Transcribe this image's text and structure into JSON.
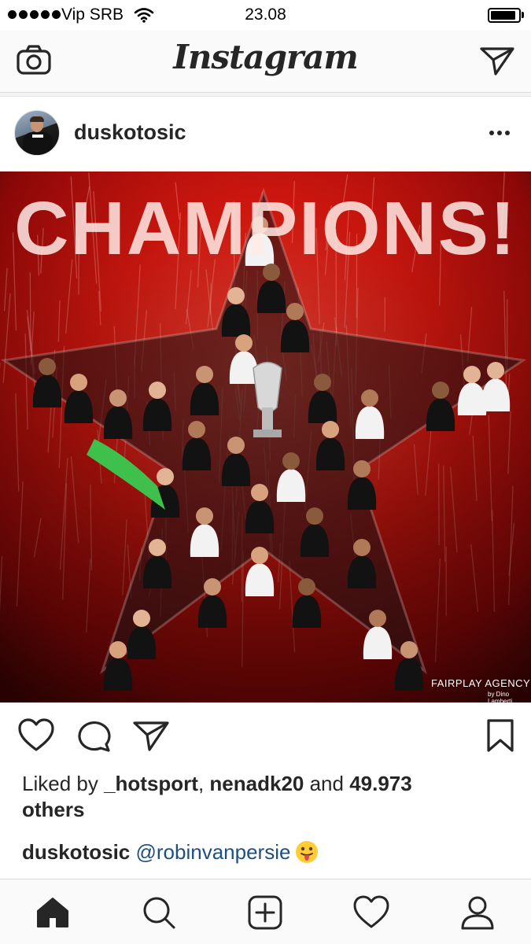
{
  "status_bar": {
    "carrier": "Vip SRB",
    "time": "23.08",
    "battery_level": 0.9,
    "signal_dots": 5
  },
  "nav": {
    "title": "Instagram",
    "camera_icon": "camera-icon",
    "direct_icon": "paper-plane-icon"
  },
  "post": {
    "username": "duskotosic",
    "image": {
      "banner_text": "CHAMPIONS!",
      "watermark": "FAIRPLAY AGENCY",
      "watermark_credit": "by Dino Lamberti",
      "colors": {
        "background": "#c51a12",
        "dark": "#3a0505"
      }
    },
    "likes": {
      "prefix": "Liked by ",
      "user1": "_hotsport",
      "separator": ", ",
      "user2": "nenadk20",
      "conjunction": " and ",
      "count": "49.973",
      "suffix": "others"
    },
    "caption": {
      "username": "duskotosic",
      "mention": "@robinvanpersie",
      "emoji": "tongue-out-emoji"
    }
  },
  "tabs": [
    {
      "name": "home",
      "icon": "home-icon",
      "active": true
    },
    {
      "name": "search",
      "icon": "search-icon",
      "active": false
    },
    {
      "name": "add",
      "icon": "add-post-icon",
      "active": false
    },
    {
      "name": "activity",
      "icon": "heart-icon",
      "active": false
    },
    {
      "name": "profile",
      "icon": "profile-icon",
      "active": false
    }
  ]
}
